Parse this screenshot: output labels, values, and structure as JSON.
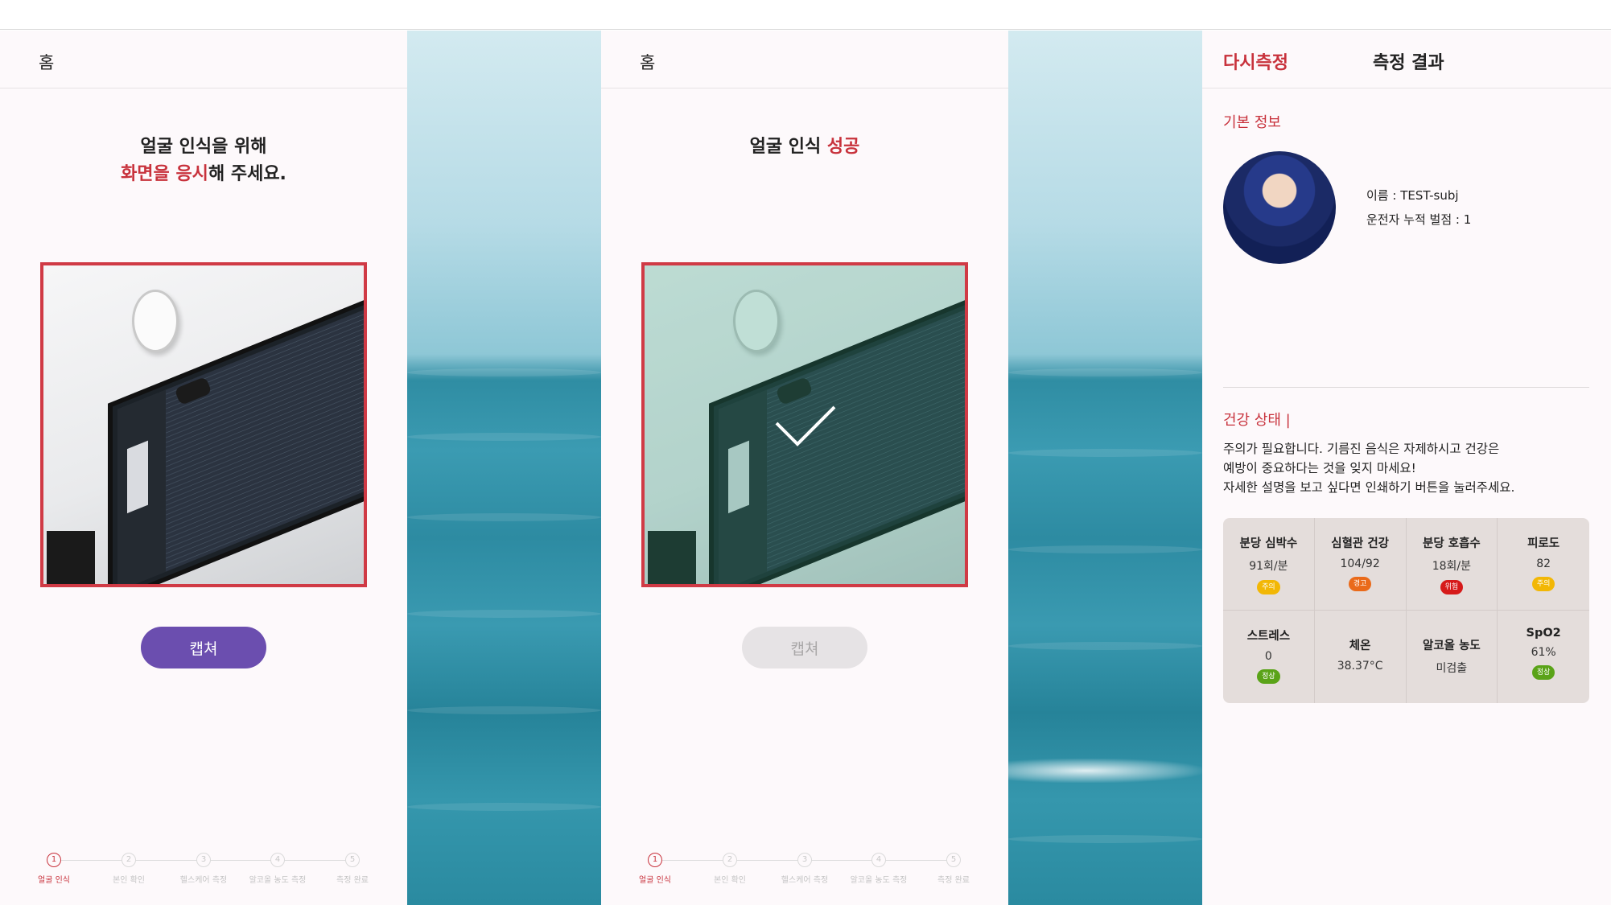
{
  "colors": {
    "accent_red": "#c8323c",
    "capture_purple": "#6b4eaf",
    "badge_caution": "#f2b705",
    "badge_warning": "#ea6a1a",
    "badge_danger": "#d61a1a",
    "badge_normal": "#5aa318"
  },
  "screen1": {
    "header_title": "홈",
    "instruction_line1": "얼굴 인식을 위해",
    "instruction_line2_highlight": "화면을 응시",
    "instruction_line2_rest": "해 주세요.",
    "capture_label": "캡쳐",
    "capture_enabled": true
  },
  "screen2": {
    "header_title": "홈",
    "result_prefix": "얼굴 인식",
    "result_highlight": "성공",
    "capture_label": "캡쳐",
    "capture_enabled": false
  },
  "steps": [
    {
      "num": "1",
      "label": "얼굴 인식",
      "active": true
    },
    {
      "num": "2",
      "label": "본인 확인",
      "active": false
    },
    {
      "num": "3",
      "label": "헬스케어 측정",
      "active": false
    },
    {
      "num": "4",
      "label": "알코올 농도 측정",
      "active": false
    },
    {
      "num": "5",
      "label": "측정 완료",
      "active": false
    }
  ],
  "screen3": {
    "retry_label": "다시측정",
    "header_title": "측정 결과",
    "basic_info_title": "기본 정보",
    "name_line": "이름 : TEST-subj",
    "points_line": "운전자 누적 벌점 : 1",
    "avatar_icon": "profile-avatar-icon",
    "health_title": "건강 상태 |",
    "health_message_line1": "주의가 필요합니다. 기름진 음식은 자제하시고 건강은",
    "health_message_line2": "예방이 중요하다는 것을 잊지 마세요!",
    "health_message_line3": "자세한 설명을 보고 싶다면 인쇄하기 버튼을 눌러주세요.",
    "metrics": [
      {
        "label": "분당 심박수",
        "value": "91회/분",
        "badge": "주의",
        "badge_color": "#f2b705"
      },
      {
        "label": "심혈관 건강",
        "value": "104/92",
        "badge": "경고",
        "badge_color": "#ea6a1a"
      },
      {
        "label": "분당 호흡수",
        "value": "18회/분",
        "badge": "위험",
        "badge_color": "#d61a1a"
      },
      {
        "label": "피로도",
        "value": "82",
        "badge": "주의",
        "badge_color": "#f2b705"
      },
      {
        "label": "스트레스",
        "value": "0",
        "badge": "정상",
        "badge_color": "#5aa318"
      },
      {
        "label": "체온",
        "value": "38.37°C",
        "badge": "",
        "badge_color": ""
      },
      {
        "label": "알코올 농도",
        "value": "미검출",
        "badge": "",
        "badge_color": ""
      },
      {
        "label": "SpO2",
        "value": "61%",
        "badge": "정상",
        "badge_color": "#5aa318"
      }
    ]
  }
}
